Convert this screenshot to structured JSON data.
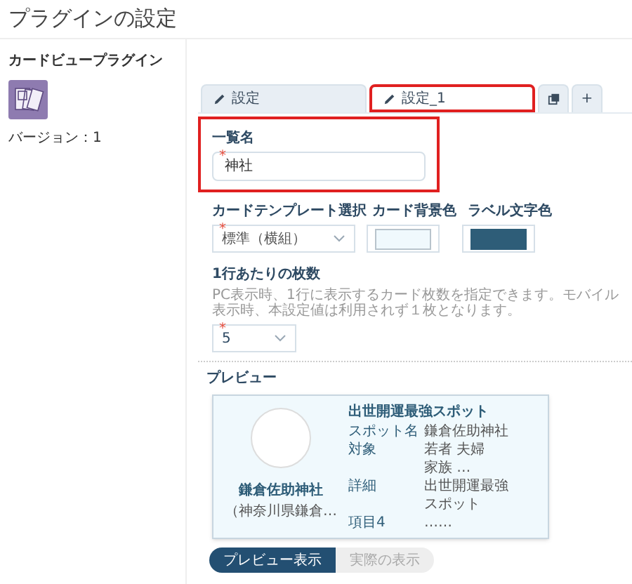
{
  "page_title": "プラグインの設定",
  "plugin": {
    "name": "カードビュープラグイン",
    "version": "バージョン：1"
  },
  "tabs": [
    {
      "kind": "named",
      "label": "設定",
      "selected": false,
      "highlighted": false
    },
    {
      "kind": "named",
      "label": "設定_1",
      "selected": true,
      "highlighted": true
    },
    {
      "kind": "copy",
      "selected": false,
      "highlighted": false
    },
    {
      "kind": "add",
      "label": "+",
      "selected": false,
      "highlighted": false
    }
  ],
  "list_name": {
    "label": "一覧名",
    "required_mark": "*",
    "value": "神社",
    "highlighted": true
  },
  "template": {
    "label": "カードテンプレート選択",
    "required_mark": "*",
    "value": "標準（横組）"
  },
  "card_bg": {
    "label": "カード背景色",
    "color": "#f0f9fd"
  },
  "label_color": {
    "label": "ラベル文字色",
    "color": "#2e5d78"
  },
  "per_row": {
    "label": "1行あたりの枚数",
    "help": "PC表示時、1行に表示するカード枚数を指定できます。モバイル表示時、本設定値は利用されず１枚となります。",
    "required_mark": "*",
    "value": "5"
  },
  "preview": {
    "label": "プレビュー",
    "card": {
      "name": "鎌倉佐助神社",
      "sub": "（神奈川県鎌倉…",
      "title": "出世開運最強スポット",
      "rows": [
        {
          "label": "スポット名",
          "lines": [
            "鎌倉佐助神社"
          ]
        },
        {
          "label": "対象",
          "lines": [
            "若者 夫婦",
            "家族 …"
          ]
        },
        {
          "label": "詳細",
          "lines": [
            "出世開運最強",
            "スポット"
          ]
        },
        {
          "label": "項目4",
          "lines": [
            "……"
          ]
        }
      ]
    },
    "modes": [
      {
        "label": "プレビュー表示",
        "selected": true
      },
      {
        "label": "実際の表示",
        "selected": false
      }
    ]
  }
}
